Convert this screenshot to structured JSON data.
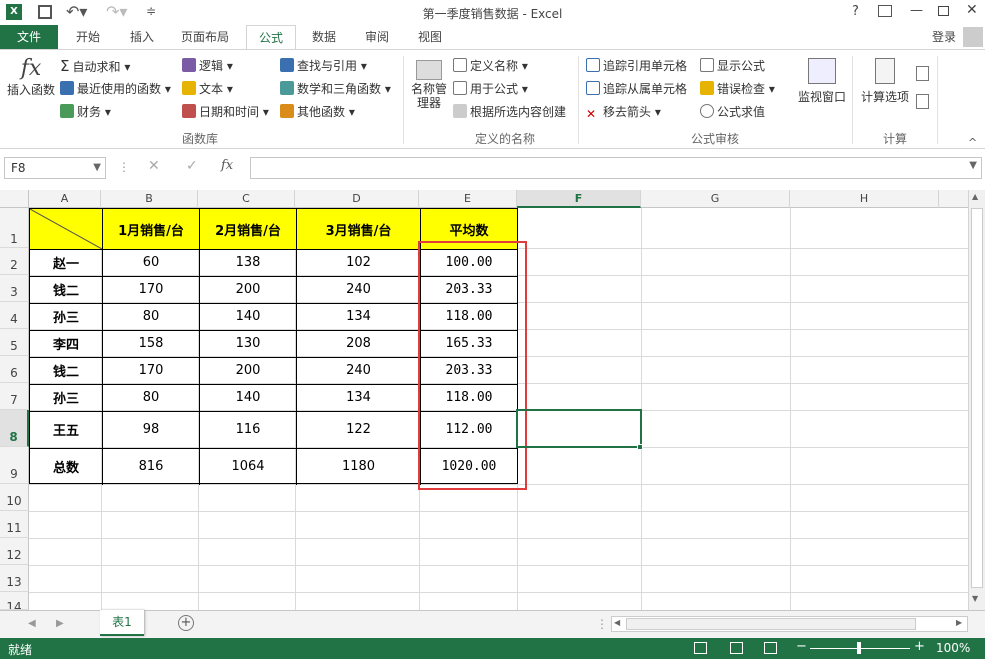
{
  "title": "第一季度销售数据 - Excel",
  "tabs": {
    "file": "文件",
    "home": "开始",
    "insert": "插入",
    "layout": "页面布局",
    "formulas": "公式",
    "data": "数据",
    "review": "审阅",
    "view": "视图"
  },
  "login": "登录",
  "ribbon": {
    "insert_function": "插入函数",
    "autosum": "自动求和",
    "recent": "最近使用的函数",
    "financial": "财务",
    "logical": "逻辑",
    "text": "文本",
    "datetime": "日期和时间",
    "lookup": "查找与引用",
    "math": "数学和三角函数",
    "more": "其他函数",
    "group_library": "函数库",
    "name_manager": "名称管理器",
    "define_name": "定义名称",
    "use_in_formula": "用于公式",
    "create_from_sel": "根据所选内容创建",
    "group_names": "定义的名称",
    "trace_prec": "追踪引用单元格",
    "trace_dep": "追踪从属单元格",
    "remove_arrows": "移去箭头",
    "show_formulas": "显示公式",
    "error_check": "错误检查",
    "eval_formula": "公式求值",
    "group_audit": "公式审核",
    "watch": "监视窗口",
    "calc_options": "计算选项",
    "group_calc": "计算"
  },
  "namebox": "F8",
  "fx": "fx",
  "columns": [
    "A",
    "B",
    "C",
    "D",
    "E",
    "F",
    "G",
    "H"
  ],
  "rows": [
    "1",
    "2",
    "3",
    "4",
    "5",
    "6",
    "7",
    "8",
    "9",
    "10",
    "11",
    "12",
    "13",
    "14"
  ],
  "headers": [
    "1月销售/台",
    "2月销售/台",
    "3月销售/台",
    "平均数"
  ],
  "table": [
    [
      "赵一",
      "60",
      "138",
      "102",
      "100.00"
    ],
    [
      "钱二",
      "170",
      "200",
      "240",
      "203.33"
    ],
    [
      "孙三",
      "80",
      "140",
      "134",
      "118.00"
    ],
    [
      "李四",
      "158",
      "130",
      "208",
      "165.33"
    ],
    [
      "钱二",
      "170",
      "200",
      "240",
      "203.33"
    ],
    [
      "孙三",
      "80",
      "140",
      "134",
      "118.00"
    ],
    [
      "王五",
      "98",
      "116",
      "122",
      "112.00"
    ],
    [
      "总数",
      "816",
      "1064",
      "1180",
      "1020.00"
    ]
  ],
  "sheet": "表1",
  "status": "就绪",
  "zoom": "100%",
  "colors": {
    "excel_green": "#217346",
    "header_yellow": "#ffff00",
    "highlight_red": "#e03c3c"
  }
}
